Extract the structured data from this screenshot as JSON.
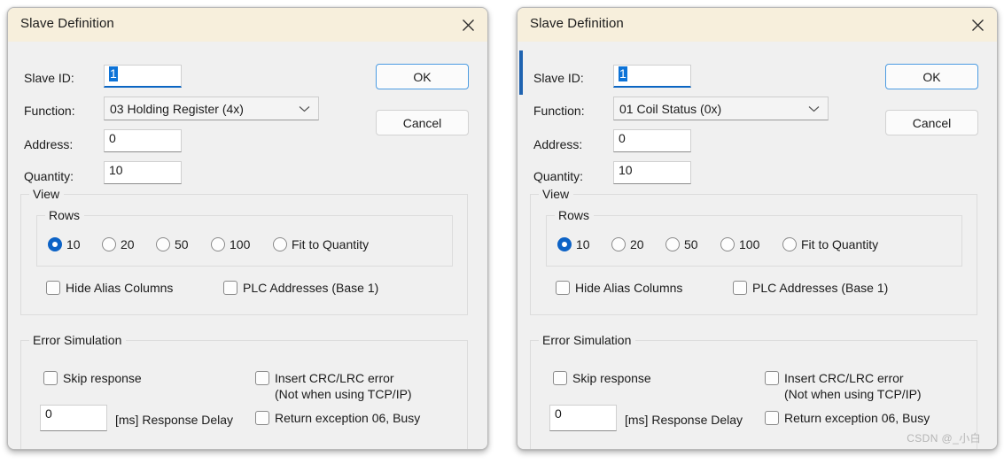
{
  "dialogs": [
    {
      "title": "Slave Definition",
      "close_icon": "close-icon",
      "fields": {
        "slave_id_label": "Slave ID:",
        "slave_id_value": "1",
        "function_label": "Function:",
        "function_value": "03 Holding Register (4x)",
        "function_chevron_icon": "chevron-down-icon",
        "address_label": "Address:",
        "address_value": "0",
        "quantity_label": "Quantity:",
        "quantity_value": "10"
      },
      "buttons": {
        "ok": "OK",
        "cancel": "Cancel"
      },
      "view_group": {
        "title": "View",
        "rows_group_title": "Rows",
        "rows_options": [
          {
            "label": "10",
            "checked": true
          },
          {
            "label": "20",
            "checked": false
          },
          {
            "label": "50",
            "checked": false
          },
          {
            "label": "100",
            "checked": false
          },
          {
            "label": "Fit to Quantity",
            "checked": false
          }
        ],
        "checkboxes": [
          {
            "label": "Hide Alias Columns",
            "checked": false
          },
          {
            "label": "PLC Addresses (Base 1)",
            "checked": false
          }
        ]
      },
      "error_group": {
        "title": "Error Simulation",
        "skip_response_label": "Skip response",
        "skip_response_checked": false,
        "delay_value": "0",
        "delay_suffix_label": "[ms] Response Delay",
        "insert_crc_label": "Insert CRC/LRC error",
        "insert_crc_sublabel": "(Not when using TCP/IP)",
        "insert_crc_checked": false,
        "return_exception_label": "Return exception 06, Busy",
        "return_exception_checked": false
      },
      "has_edge_accent": false,
      "watermark": ""
    },
    {
      "title": "Slave Definition",
      "close_icon": "close-icon",
      "fields": {
        "slave_id_label": "Slave ID:",
        "slave_id_value": "1",
        "function_label": "Function:",
        "function_value": "01 Coil Status (0x)",
        "function_chevron_icon": "chevron-down-icon",
        "address_label": "Address:",
        "address_value": "0",
        "quantity_label": "Quantity:",
        "quantity_value": "10"
      },
      "buttons": {
        "ok": "OK",
        "cancel": "Cancel"
      },
      "view_group": {
        "title": "View",
        "rows_group_title": "Rows",
        "rows_options": [
          {
            "label": "10",
            "checked": true
          },
          {
            "label": "20",
            "checked": false
          },
          {
            "label": "50",
            "checked": false
          },
          {
            "label": "100",
            "checked": false
          },
          {
            "label": "Fit to Quantity",
            "checked": false
          }
        ],
        "checkboxes": [
          {
            "label": "Hide Alias Columns",
            "checked": false
          },
          {
            "label": "PLC Addresses (Base 1)",
            "checked": false
          }
        ]
      },
      "error_group": {
        "title": "Error Simulation",
        "skip_response_label": "Skip response",
        "skip_response_checked": false,
        "delay_value": "0",
        "delay_suffix_label": "[ms] Response Delay",
        "insert_crc_label": "Insert CRC/LRC error",
        "insert_crc_sublabel": "(Not when using TCP/IP)",
        "insert_crc_checked": false,
        "return_exception_label": "Return exception 06, Busy",
        "return_exception_checked": false
      },
      "has_edge_accent": true,
      "watermark": "CSDN @_小白"
    }
  ],
  "colors": {
    "titlebar": "#f7efdc",
    "dialog_bg": "#f0f0f0",
    "accent_blue": "#0d63c6",
    "selection_blue": "#0d73d7",
    "default_btn_border": "#4a9ae0"
  }
}
